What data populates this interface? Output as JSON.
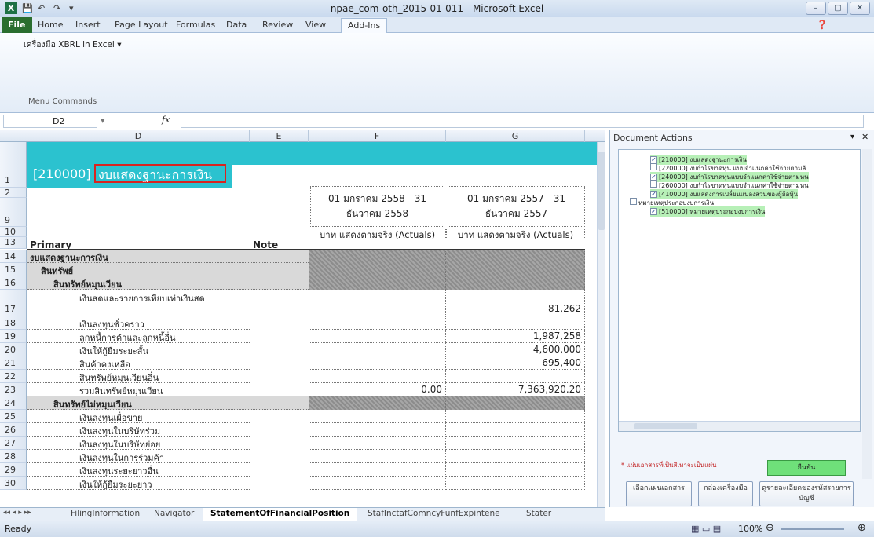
{
  "window": {
    "title": "npae_com-oth_2015-01-011 - Microsoft Excel"
  },
  "tabs": [
    "File",
    "Home",
    "Insert",
    "Page Layout",
    "Formulas",
    "Data",
    "Review",
    "View",
    "Add-Ins"
  ],
  "active_tab": "Add-Ins",
  "ribbon": {
    "menu_item": "เครื่องมือ XBRL in Excel ▾",
    "group_label": "Menu Commands"
  },
  "formula_bar": {
    "name_box": "D2",
    "fx": "fx",
    "formula": ""
  },
  "columns": [
    "D",
    "E",
    "F",
    "G"
  ],
  "header_row": {
    "code": "[210000]",
    "title": "งบแสดงฐานะการเงิน"
  },
  "periods": {
    "f_period": "01 มกราคม 2558 - 31 ธันวาคม 2558",
    "g_period": "01 มกราคม 2557 - 31 ธันวาคม 2557",
    "f_unit": "บาท แสดงตามจริง (Actuals)",
    "g_unit": "บาท แสดงตามจริง (Actuals)"
  },
  "labels": {
    "primary": "Primary",
    "note": "Note"
  },
  "rows": [
    {
      "n": "14",
      "label": "งบแสดงฐานะการเงิน",
      "f": "",
      "g": ""
    },
    {
      "n": "15",
      "label": "สินทรัพย์",
      "f": "",
      "g": ""
    },
    {
      "n": "16",
      "label": "สินทรัพย์หมุนเวียน",
      "f": "",
      "g": ""
    },
    {
      "n": "17",
      "label": "เงินสดและรายการเทียบเท่าเงินสด",
      "f": "",
      "g": "81,262"
    },
    {
      "n": "18",
      "label": "เงินลงทุนชั่วคราว",
      "f": "",
      "g": ""
    },
    {
      "n": "19",
      "label": "ลูกหนี้การค้าและลูกหนี้อื่น",
      "f": "",
      "g": "1,987,258"
    },
    {
      "n": "20",
      "label": "เงินให้กู้ยืมระยะสั้น",
      "f": "",
      "g": "4,600,000"
    },
    {
      "n": "21",
      "label": "สินค้าคงเหลือ",
      "f": "",
      "g": "695,400"
    },
    {
      "n": "22",
      "label": "สินทรัพย์หมุนเวียนอื่น",
      "f": "",
      "g": ""
    },
    {
      "n": "23",
      "label": "รวมสินทรัพย์หมุนเวียน",
      "f": "0.00",
      "g": "7,363,920.20"
    },
    {
      "n": "24",
      "label": "สินทรัพย์ไม่หมุนเวียน",
      "f": "",
      "g": ""
    },
    {
      "n": "25",
      "label": "เงินลงทุนเผื่อขาย",
      "f": "",
      "g": ""
    },
    {
      "n": "26",
      "label": "เงินลงทุนในบริษัทร่วม",
      "f": "",
      "g": ""
    },
    {
      "n": "27",
      "label": "เงินลงทุนในบริษัทย่อย",
      "f": "",
      "g": ""
    },
    {
      "n": "28",
      "label": "เงินลงทุนในการร่วมค้า",
      "f": "",
      "g": ""
    },
    {
      "n": "29",
      "label": "เงินลงทุนระยะยาวอื่น",
      "f": "",
      "g": ""
    },
    {
      "n": "30",
      "label": "เงินให้กู้ยืมระยะยาว",
      "f": "",
      "g": ""
    }
  ],
  "small_rows": [
    "1",
    "2",
    "9",
    "10",
    "13"
  ],
  "pane": {
    "title": "Document Actions",
    "tree": [
      {
        "text": "[210000] งบแสดงฐานะการเงิน",
        "checked": true
      },
      {
        "text": "[220000] งบกำไรขาดทุน แบบจำแนกค่าใช้จ่ายตามลั",
        "checked": false
      },
      {
        "text": "[240000] งบกำไรขาดทุนแบบจำแนกค่าใช้จ่ายตามหน",
        "checked": true
      },
      {
        "text": "[260000] งบกำไรขาดทุนแบบจำแนกค่าใช้จ่ายตามหน",
        "checked": false
      },
      {
        "text": "[410000] งบแสดงการเปลี่ยนแปลงส่วนของผู้ถือหุ้น",
        "checked": true
      },
      {
        "text": "หมายเหตุประกอบงบการเงิน",
        "checked": false
      },
      {
        "text": "[510000] หมายเหตุประกอบงบการเงิน",
        "checked": true
      }
    ],
    "note": "* แผ่นเอกสารที่เป็นสีเทาจะเป็นแผ่น",
    "ok_label": "ยืนยัน",
    "buttons": [
      "เลือกแผ่นเอกสาร",
      "กล่องเครื่องมือ",
      "ดูรายละเอียดของรหัสรายการบัญชี"
    ]
  },
  "sheet_tabs": [
    "FilingInformation",
    "Navigator",
    "StatementOfFinancialPosition",
    "StafInctafComncyFunfExpintene",
    "Stater"
  ],
  "active_sheet": "StatementOfFinancialPosition",
  "status": {
    "ready": "Ready",
    "zoom": "100%"
  }
}
